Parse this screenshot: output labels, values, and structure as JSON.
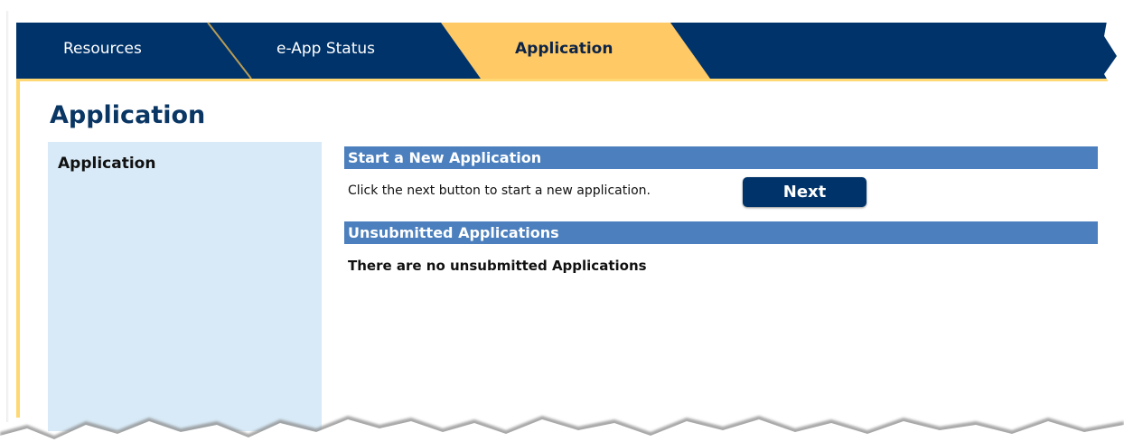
{
  "tabs": [
    {
      "label": "Resources",
      "active": false
    },
    {
      "label": "e-App Status",
      "active": false
    },
    {
      "label": "Application",
      "active": true
    }
  ],
  "page": {
    "title": "Application"
  },
  "sidebar": {
    "items": [
      {
        "label": "Application"
      }
    ]
  },
  "sections": {
    "new_application": {
      "header": "Start a New Application",
      "hint": "Click the next button to start a new application.",
      "next_label": "Next"
    },
    "unsubmitted": {
      "header": "Unsubmitted Applications",
      "empty_message": "There are no unsubmitted Applications"
    }
  },
  "colors": {
    "nav_bar": "#00336a",
    "active_tab": "#ffc966",
    "section_header": "#4b7fbd",
    "sidebar_bg": "#d8eaf7",
    "accent_border": "#ffd773",
    "title_text": "#0a3664"
  }
}
